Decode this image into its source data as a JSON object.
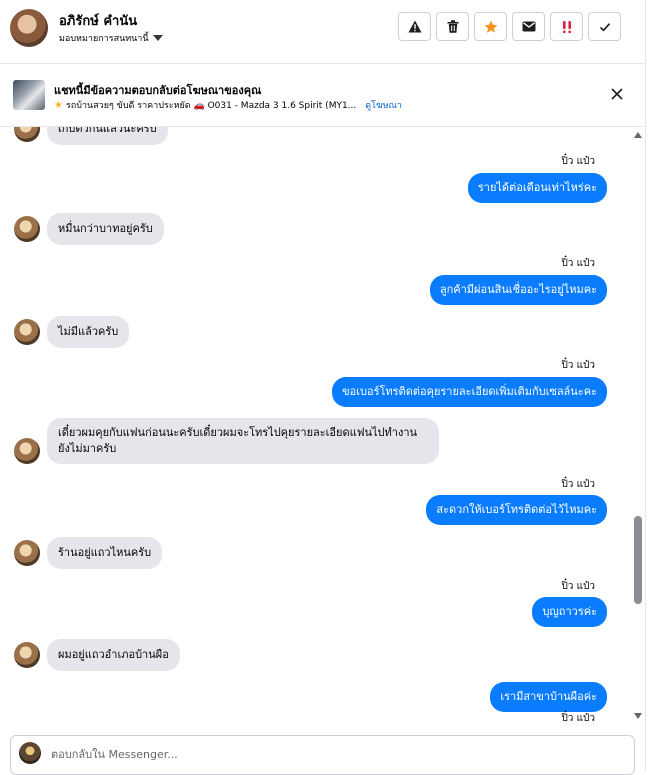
{
  "header": {
    "contact_name": "อภิรักษ์ คำนัน",
    "assign_label": "มอบหมายการสนทนานี้",
    "actions": [
      "warning-icon",
      "trash-icon",
      "star-icon",
      "envelope-icon",
      "spam-icon",
      "check-icon"
    ]
  },
  "banner": {
    "title": "แชทนี้มีข้อความตอบกลับต่อโฆษณาของคุณ",
    "subtitle": "รถบ้านสวยๆ ขับดี ราคาประหยัด 🚗 O031 - Mazda 3 1.6 Spirit (MY1...",
    "link": "ดูโฆษณา"
  },
  "messages": [
    {
      "dir": "in",
      "text": "เก็บตัวกันแล้วนะครับ"
    },
    {
      "dir": "seen",
      "text": "ปิ๋ว แป๋ว"
    },
    {
      "dir": "out",
      "text": "รายได้ต่อเดือนเท่าไหร่คะ"
    },
    {
      "dir": "in",
      "text": "หมื่นกว่าบาทอยู่ครับ"
    },
    {
      "dir": "seen",
      "text": "ปิ๋ว แป๋ว"
    },
    {
      "dir": "out",
      "text": "ลูกค้ามีผ่อนสินเชื่ออะไรอยู่ไหมคะ"
    },
    {
      "dir": "in",
      "text": "ไม่มีแล้วครับ"
    },
    {
      "dir": "seen",
      "text": "ปิ๋ว แป๋ว"
    },
    {
      "dir": "out",
      "text": "ขอเบอร์โทรติดต่อคุยรายละเอียดเพิ่มเติมกับเซลล์นะคะ"
    },
    {
      "dir": "in",
      "text": "เดี๋ยวผมคุยกับแฟนก่อนนะครับเดี๋ยวผมจะโทรไปคุยรายละเอียดแฟนไปทำงานยังไม่มาครับ"
    },
    {
      "dir": "seen",
      "text": "ปิ๋ว แป๋ว"
    },
    {
      "dir": "out",
      "text": "สะดวกให้เบอร์โทรติดต่อไว้ไหมคะ"
    },
    {
      "dir": "in",
      "text": "ร้านอยู่แถวไหนครับ"
    },
    {
      "dir": "seen",
      "text": "ปิ๋ว แป๋ว"
    },
    {
      "dir": "out",
      "text": "บุญถาวรค่ะ"
    },
    {
      "dir": "in",
      "text": "ผมอยู่แถวอำเภอบ้านผือ"
    },
    {
      "dir": "out",
      "text": "เรามีสาขาบ้านผือค่ะ"
    },
    {
      "dir": "seen",
      "text": "ปิ๋ว แป๋ว"
    }
  ],
  "composer": {
    "placeholder": "ตอบกลับใน Messenger..."
  },
  "colors": {
    "outgoing": "#0a7cff",
    "incoming": "#e4e6eb",
    "star": "#f7931e",
    "spam": "#e41e3f",
    "link": "#0064d1"
  }
}
